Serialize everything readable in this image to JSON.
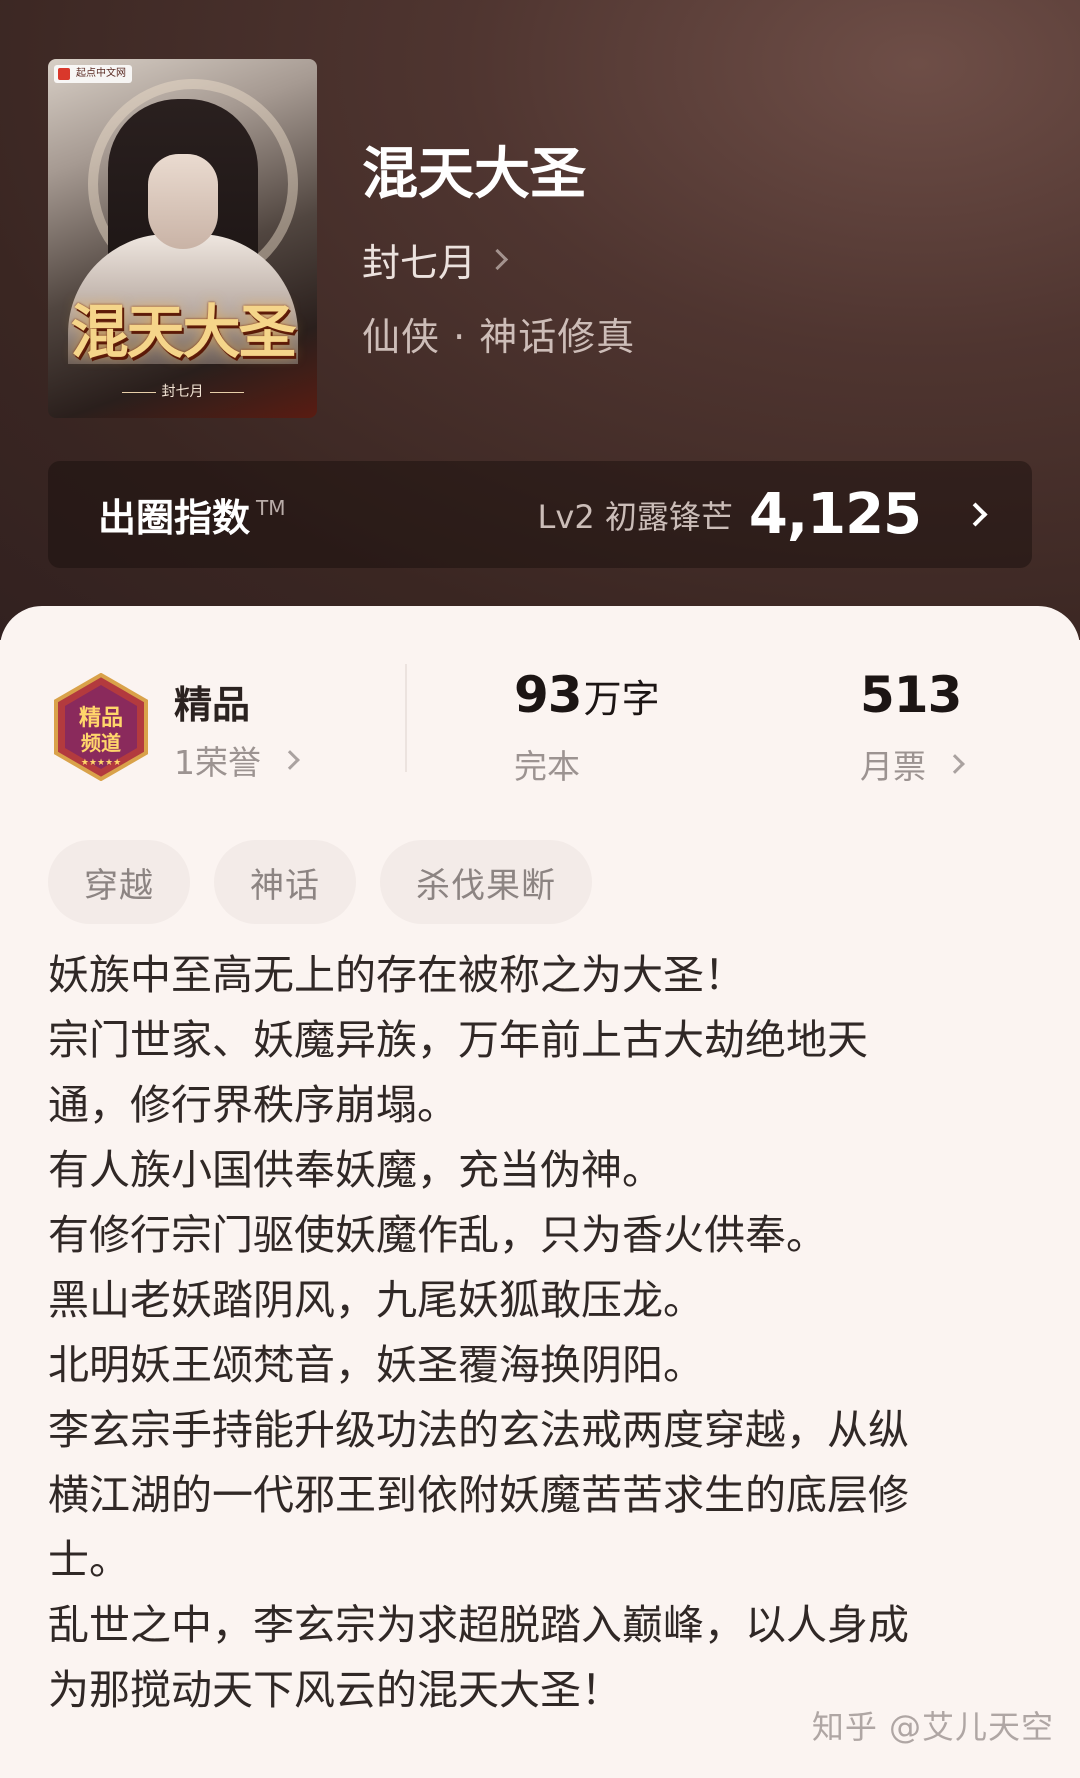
{
  "book": {
    "cover": {
      "publisher_badge": "起点中文网",
      "title_art": "混天大圣",
      "author_line": "封七月"
    },
    "title": "混天大圣",
    "author": "封七月",
    "genre": "仙侠 · 神话修真"
  },
  "circle_index": {
    "label": "出圈指数",
    "tm": "TM",
    "level": "Lv2 初露锋芒",
    "score": "4,125"
  },
  "stats": {
    "quality": {
      "icon": "jingpin-badge-icon",
      "title": "精品",
      "sub": "1荣誉"
    },
    "words": {
      "value": "93",
      "unit": "万字",
      "sub": "完本"
    },
    "votes": {
      "value": "513",
      "sub": "月票"
    }
  },
  "tags": [
    "穿越",
    "神话",
    "杀伐果断"
  ],
  "description_lines": [
    "妖族中至高无上的存在被称之为大圣！",
    "宗门世家、妖魔异族，万年前上古大劫绝地天",
    "通，修行界秩序崩塌。",
    "有人族小国供奉妖魔，充当伪神。",
    "有修行宗门驱使妖魔作乱，只为香火供奉。",
    "黑山老妖踏阴风，九尾妖狐敢压龙。",
    "北明妖王颂梵音，妖圣覆海换阴阳。",
    "李玄宗手持能升级功法的玄法戒两度穿越，从纵",
    "横江湖的一代邪王到依附妖魔苦苦求生的底层修",
    "士。",
    "乱世之中，李玄宗为求超脱踏入巅峰，以人身成",
    "为那搅动天下风云的混天大圣！"
  ],
  "watermark": "知乎 @艾儿天空",
  "colors": {
    "header_bg": "#4a302b",
    "card_bg": "#fbf4f1",
    "tag_bg": "#f3ebe8",
    "text_dark": "#302826",
    "text_muted": "#9c9391"
  }
}
